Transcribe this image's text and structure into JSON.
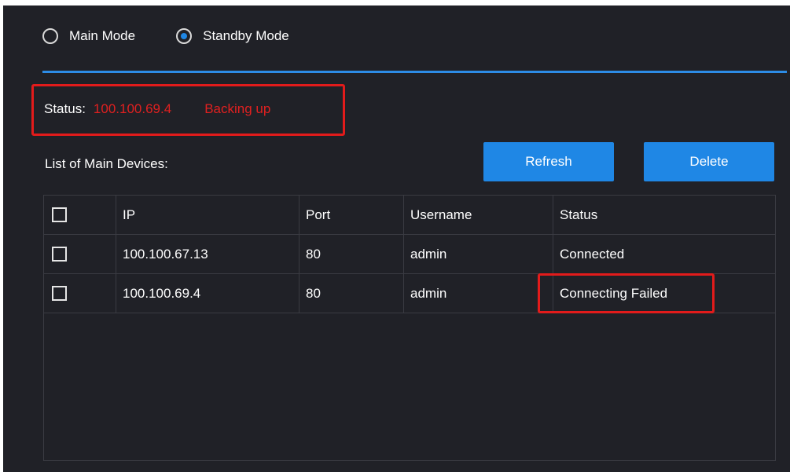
{
  "mode": {
    "options": [
      {
        "label": "Main Mode",
        "checked": false
      },
      {
        "label": "Standby Mode",
        "checked": true
      }
    ]
  },
  "status": {
    "label": "Status:",
    "ip": "100.100.69.4",
    "state": "Backing up"
  },
  "list": {
    "title": "List of Main Devices:",
    "refresh_label": "Refresh",
    "delete_label": "Delete"
  },
  "table": {
    "headers": [
      "IP",
      "Port",
      "Username",
      "Status"
    ],
    "rows": [
      {
        "ip": "100.100.67.13",
        "port": "80",
        "username": "admin",
        "status": "Connected"
      },
      {
        "ip": "100.100.69.4",
        "port": "80",
        "username": "admin",
        "status": "Connecting Failed"
      }
    ]
  },
  "colors": {
    "background": "#202127",
    "accent": "#1f87e5",
    "error": "#e02020",
    "highlight": "#e21b1b"
  }
}
